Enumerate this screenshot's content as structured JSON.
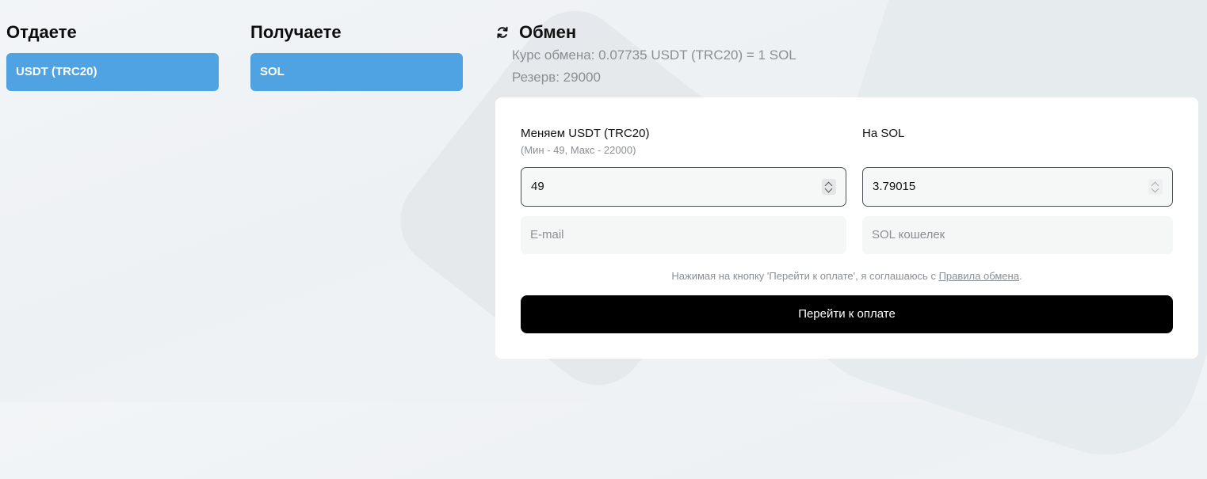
{
  "give": {
    "title": "Отдаете",
    "currency": "USDT (TRC20)"
  },
  "receive": {
    "title": "Получаете",
    "currency": "SOL"
  },
  "exchange": {
    "title": "Обмен",
    "rate": "Курс обмена: 0.07735 USDT (TRC20) = 1 SOL",
    "reserve": "Резерв: 29000",
    "icon": "refresh-icon"
  },
  "form": {
    "from_label": "Меняем USDT (TRC20)",
    "from_limits": "(Мин - 49, Макс - 22000)",
    "to_label": "На SOL",
    "from_amount": "49",
    "to_amount": "3.79015",
    "email_placeholder": "E-mail",
    "wallet_placeholder": "SOL кошелек",
    "agree_text": "Нажимая на кнопку 'Перейти к оплате', я соглашаюсь с",
    "agree_link": "Правила обмена",
    "agree_end": ".",
    "submit_label": "Перейти к оплате"
  },
  "colors": {
    "accent": "#4fa3e3",
    "button": "#000000",
    "muted_text": "#8a8f94"
  }
}
